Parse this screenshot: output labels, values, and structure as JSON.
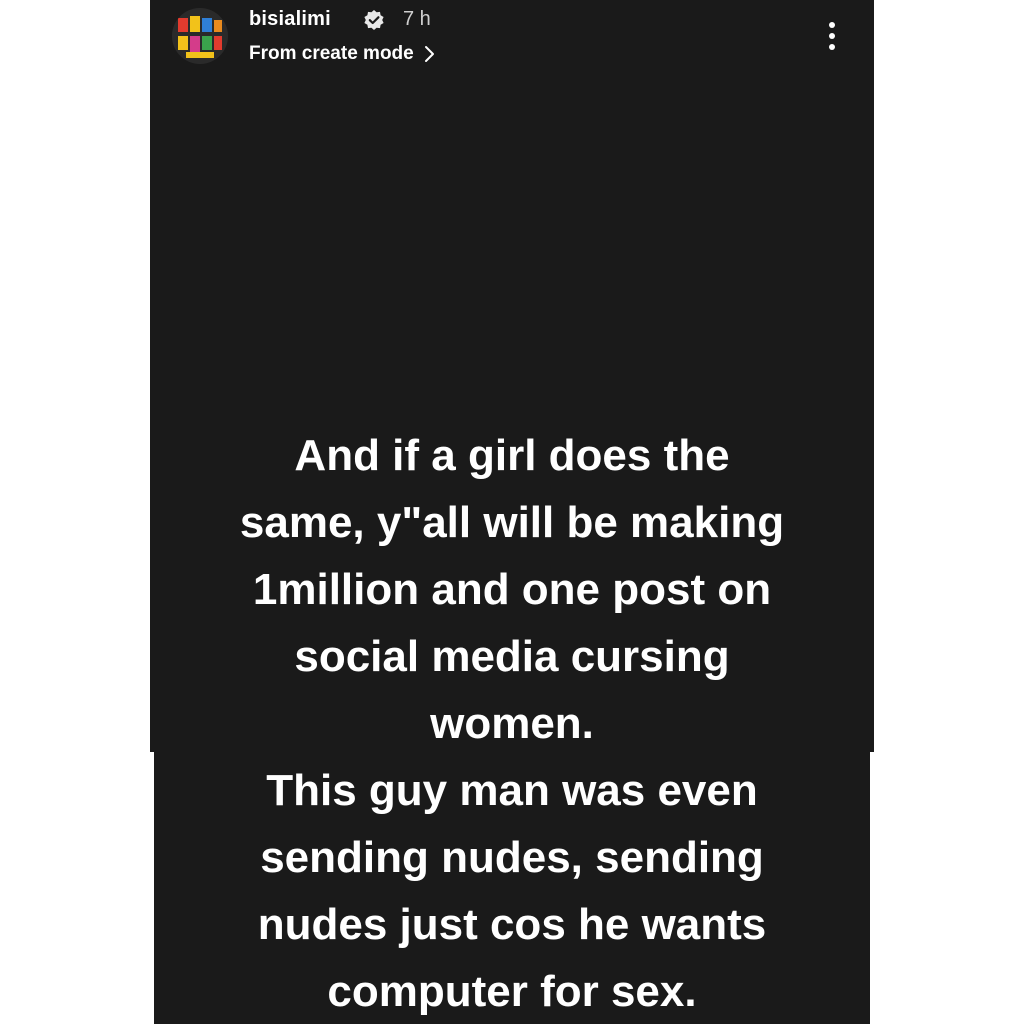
{
  "story": {
    "username": "bisialimi",
    "time": "7 h",
    "subtitle": "From create mode",
    "lines": [
      "And if a girl does the",
      "same, y\"all will be making",
      "1million and one post on",
      "social media cursing",
      "women.",
      "This guy man was even",
      "sending nudes, sending",
      "nudes just cos he wants",
      "computer for sex."
    ]
  },
  "icons": {
    "verified": "verified-badge-icon",
    "chevron": "chevron-right-icon",
    "more": "more-vertical-icon"
  },
  "colors": {
    "background": "#1a1a1a",
    "text": "#ffffff",
    "time": "#cfcfcf"
  }
}
